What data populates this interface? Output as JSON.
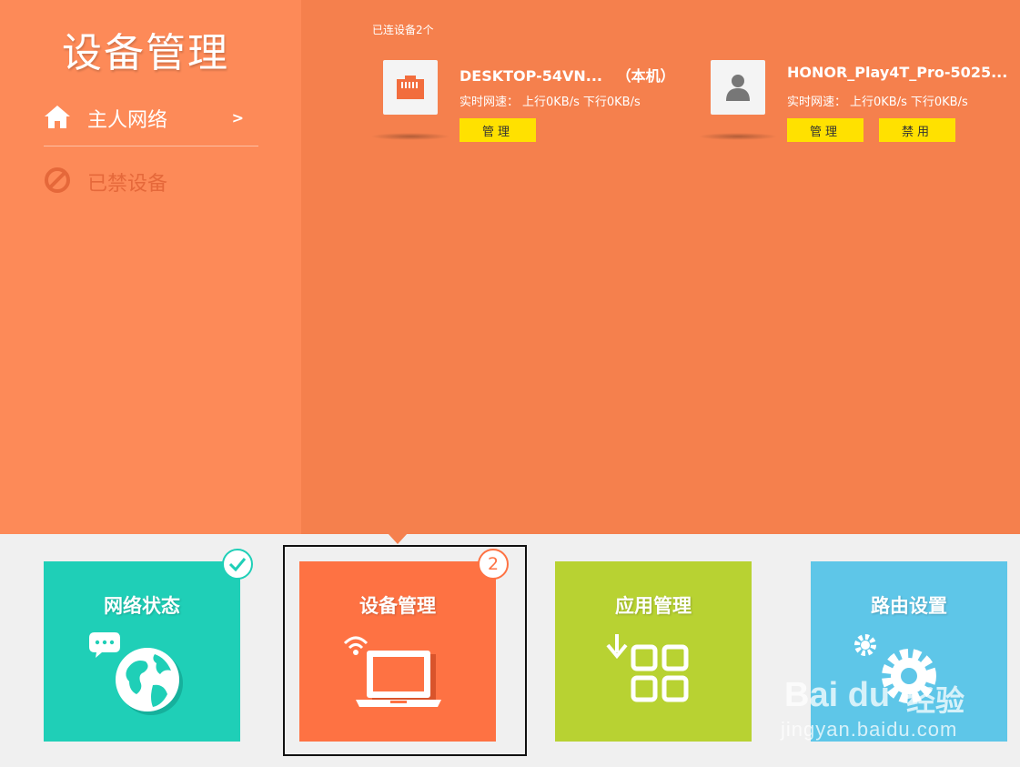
{
  "sidebar": {
    "title": "设备管理",
    "items": [
      {
        "label": "主人网络",
        "icon": "home-icon",
        "arrow": ">",
        "active": true
      },
      {
        "label": "已禁设备",
        "icon": "blocked-icon",
        "active": false
      }
    ]
  },
  "main": {
    "connected_text": "已连设备2个",
    "devices": [
      {
        "name": "DESKTOP-54VN...",
        "tag": "（本机）",
        "icon": "ethernet-port-icon",
        "speed_label": "实时网速：",
        "up": "上行0KB/s",
        "down": "下行0KB/s",
        "buttons": [
          "管理"
        ]
      },
      {
        "name": "HONOR_Play4T_Pro-5025...",
        "tag": "",
        "icon": "user-icon",
        "speed_label": "实时网速：",
        "up": "上行0KB/s",
        "down": "下行0KB/s",
        "buttons": [
          "管理",
          "禁用"
        ]
      }
    ]
  },
  "tiles": [
    {
      "label": "网络状态",
      "icon": "globe-chat-icon",
      "color": "#1fcfb7",
      "badge": "check"
    },
    {
      "label": "设备管理",
      "icon": "laptop-wifi-icon",
      "color": "#fe7243",
      "badge": "2",
      "selected": true
    },
    {
      "label": "应用管理",
      "icon": "apps-download-icon",
      "color": "#b8d232"
    },
    {
      "label": "路由设置",
      "icon": "gears-icon",
      "color": "#5ec6e8"
    }
  ],
  "watermark": {
    "brand": "Bai du",
    "cn": "经验",
    "url": "jingyan.baidu.com"
  },
  "colors": {
    "sidebar_bg": "#fd8a58",
    "main_bg": "#f5804d",
    "button_yellow": "#ffe100",
    "footer_bg": "#f0f0f0"
  }
}
